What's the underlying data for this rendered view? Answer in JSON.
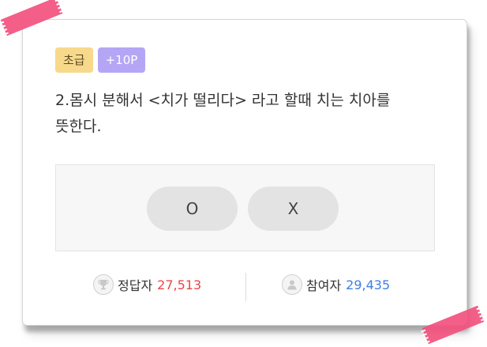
{
  "quiz": {
    "level_badge": "초급",
    "point_badge": "+10P",
    "question_line1": "2.몸시 분해서 <치가 떨리다> 라고 할때 치는 치아를",
    "question_line2": "뜻한다.",
    "answers": {
      "o_label": "O",
      "x_label": "X"
    },
    "stats": {
      "correct_label": "정답자",
      "correct_count": "27,513",
      "participant_label": "참여자",
      "participant_count": "29,435"
    }
  },
  "colors": {
    "tape": "#f2527e",
    "level_badge_bg": "#f7d98b",
    "point_badge_bg": "#b5a6f5",
    "correct_count": "#e8474a",
    "participant_count": "#3f7fe0"
  },
  "icons": {
    "correct": "trophy-icon",
    "participant": "person-icon"
  }
}
